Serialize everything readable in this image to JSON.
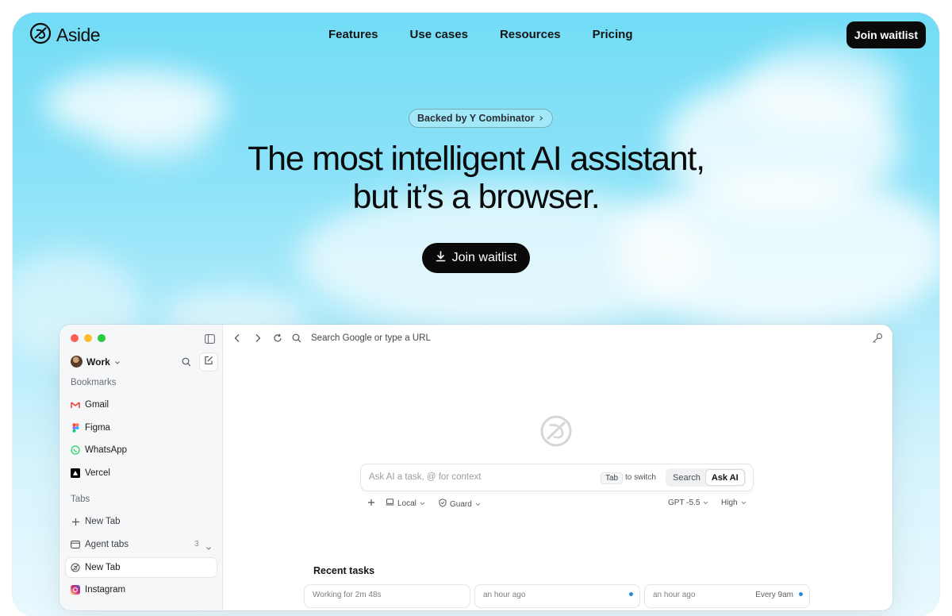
{
  "brand": {
    "name": "Aside"
  },
  "nav": {
    "links": [
      "Features",
      "Use cases",
      "Resources",
      "Pricing"
    ],
    "cta": "Join waitlist"
  },
  "hero": {
    "badge": "Backed by Y Combinator",
    "title_line1": "The most intelligent AI assistant,",
    "title_line2": "but it’s a browser.",
    "cta": "Join waitlist"
  },
  "browser": {
    "sidebar": {
      "profile": "Work",
      "bookmarks_label": "Bookmarks",
      "bookmarks": [
        "Gmail",
        "Figma",
        "WhatsApp",
        "Vercel"
      ],
      "tabs_label": "Tabs",
      "new_tab_action": "New Tab",
      "agent_tabs": "Agent tabs",
      "agent_tabs_count": "3",
      "tabs": [
        "New Tab",
        "Instagram"
      ]
    },
    "urlbar": {
      "placeholder": "Search Google or type a URL"
    },
    "ask": {
      "placeholder": "Ask AI a task, @ for context",
      "kbd": "Tab",
      "switch_text": "to switch",
      "modes": [
        "Search",
        "Ask AI"
      ],
      "active_mode": "Ask AI"
    },
    "options": {
      "mode": "Local",
      "guard": "Guard",
      "model": "GPT -5.5",
      "effort": "High"
    },
    "recent": {
      "title": "Recent tasks",
      "cards": [
        {
          "text": "Working for 2m 48s",
          "when": ""
        },
        {
          "text": "an hour ago",
          "when": ""
        },
        {
          "text": "an hour ago",
          "when": "Every 9am"
        }
      ]
    }
  },
  "colors": {
    "sky": "#8fe3f8",
    "dark": "#0a0a0a",
    "accent": "#2a8bd8"
  }
}
